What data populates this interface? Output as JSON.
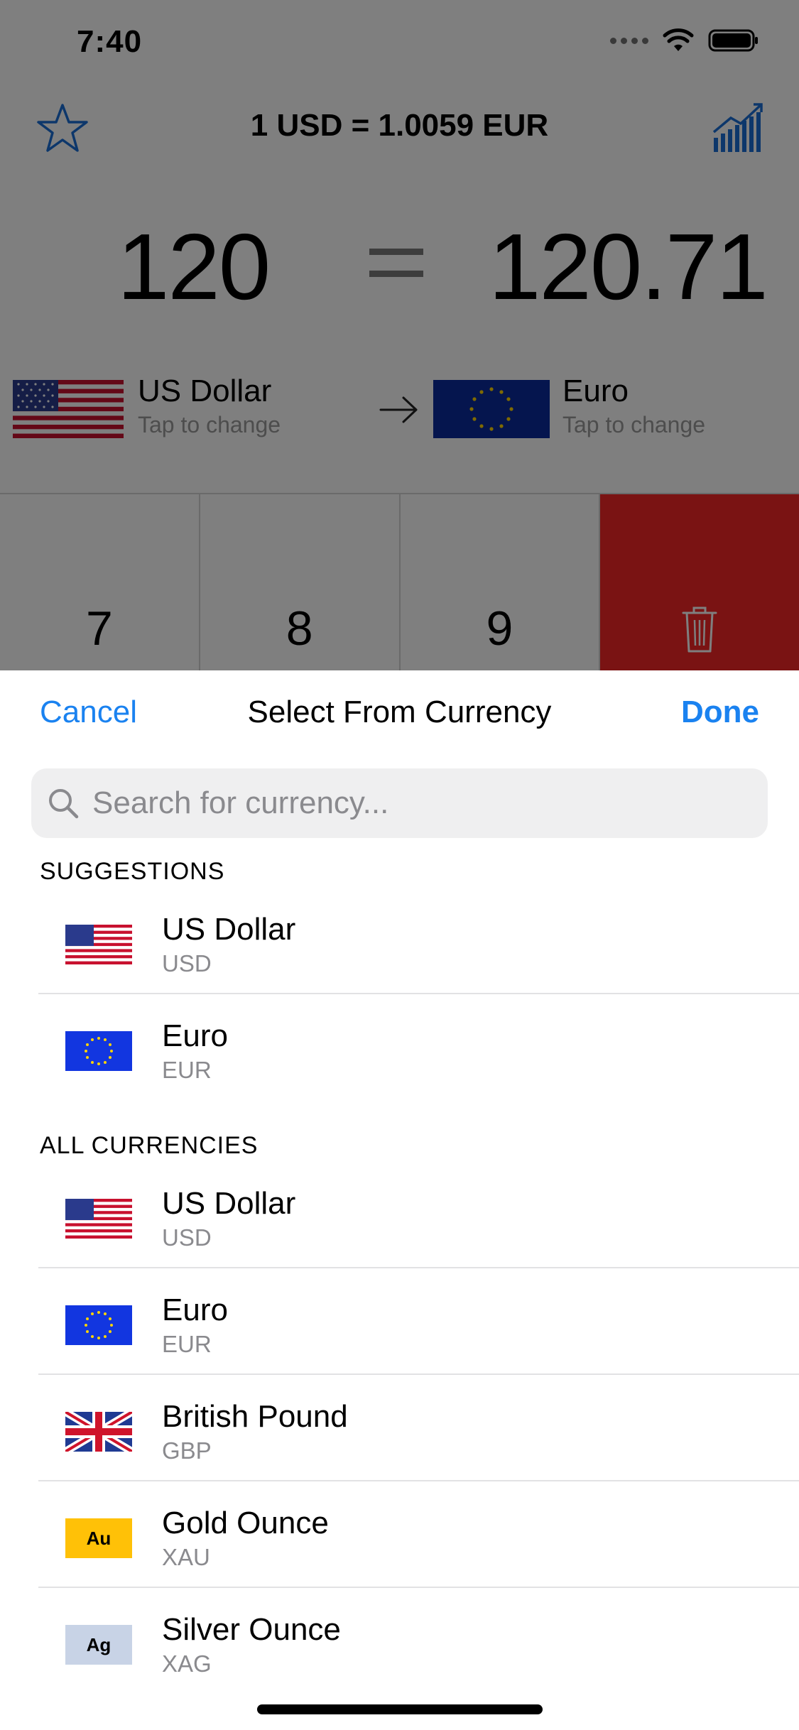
{
  "status": {
    "time": "7:40"
  },
  "converter": {
    "rate_title": "1 USD = 1.0059 EUR",
    "amount_from": "120",
    "amount_to": "120.71",
    "from": {
      "name": "US Dollar",
      "hint": "Tap to change"
    },
    "to": {
      "name": "Euro",
      "hint": "Tap to change"
    },
    "keys": [
      "7",
      "8",
      "9"
    ]
  },
  "sheet": {
    "cancel_label": "Cancel",
    "title": "Select From Currency",
    "done_label": "Done",
    "search_placeholder": "Search for currency...",
    "suggestions_header": "SUGGESTIONS",
    "suggestions": [
      {
        "name": "US Dollar",
        "code": "USD",
        "flag": "us-flag"
      },
      {
        "name": "Euro",
        "code": "EUR",
        "flag": "eu-flag"
      }
    ],
    "all_header": "ALL CURRENCIES",
    "all": [
      {
        "name": "US Dollar",
        "code": "USD",
        "flag": "us-flag"
      },
      {
        "name": "Euro",
        "code": "EUR",
        "flag": "eu-flag"
      },
      {
        "name": "British Pound",
        "code": "GBP",
        "flag": "uk-flag"
      },
      {
        "name": "Gold Ounce",
        "code": "XAU",
        "flag": "gold-chip",
        "chip_text": "Au"
      },
      {
        "name": "Silver Ounce",
        "code": "XAG",
        "flag": "silver-chip",
        "chip_text": "Ag"
      }
    ]
  },
  "colors": {
    "accent": "#1a82f0",
    "delete_key": "#f42626",
    "gold": "#ffc107",
    "silver": "#c8d3e6"
  }
}
